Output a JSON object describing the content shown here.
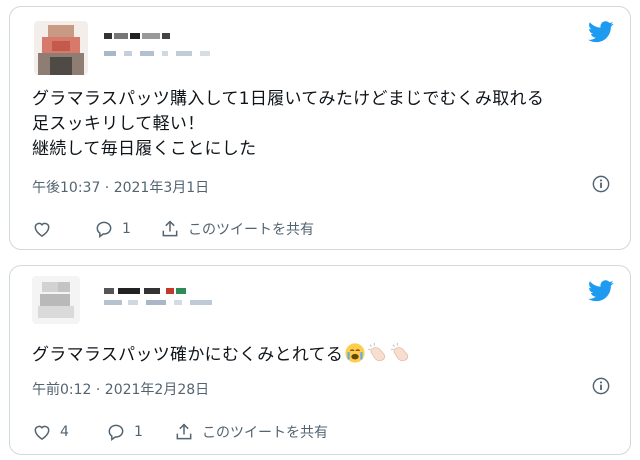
{
  "brand_color": "#1d9bf0",
  "tweets": [
    {
      "text": "グラマラスパッツ購入して1日履いてみたけどまじでむくみ取れる\n足スッキリして軽い！\n継続して毎日履くことにした",
      "emoji": [],
      "timestamp": "午後10:37 · 2021年3月1日",
      "like_count": "",
      "reply_count": "1",
      "share_label": "このツイートを共有",
      "icons": [
        "heart-icon",
        "reply-icon",
        "share-icon",
        "info-icon",
        "twitter-bird-icon"
      ]
    },
    {
      "text": "グラマラスパッツ確かにむくみとれてる",
      "emoji": [
        "crying-face-emoji",
        "clapping-hands-emoji",
        "clapping-hands-emoji"
      ],
      "timestamp": "午前0:12 · 2021年2月28日",
      "like_count": "4",
      "reply_count": "1",
      "share_label": "このツイートを共有",
      "icons": [
        "heart-icon",
        "reply-icon",
        "share-icon",
        "info-icon",
        "twitter-bird-icon"
      ]
    }
  ]
}
